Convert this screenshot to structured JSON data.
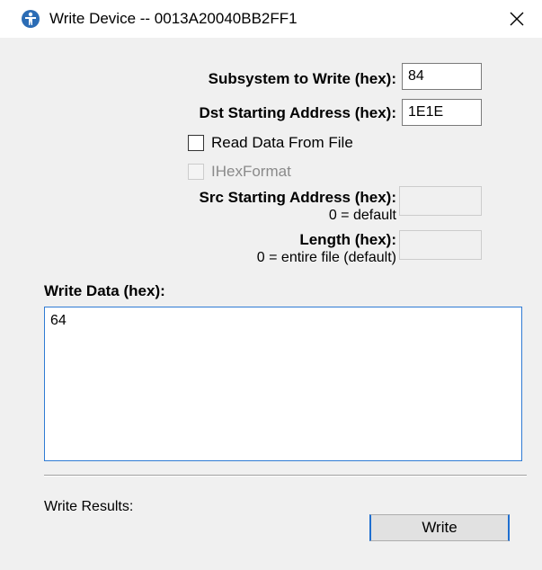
{
  "window": {
    "title": "Write Device -- 0013A20040BB2FF1",
    "app_icon": "xctu-app-icon",
    "close_icon": "close-icon"
  },
  "form": {
    "subsystem": {
      "label": "Subsystem to Write (hex):",
      "value": "84"
    },
    "dst_address": {
      "label": "Dst Starting Address (hex):",
      "value": "1E1E"
    },
    "read_from_file": {
      "label": "Read Data From File",
      "checked": false
    },
    "ihex_format": {
      "label": "IHexFormat",
      "checked": false,
      "enabled": false
    },
    "src_address": {
      "label": "Src Starting Address (hex):",
      "sublabel": "0 = default",
      "value": ""
    },
    "length": {
      "label": "Length (hex):",
      "sublabel": "0 = entire file (default)",
      "value": ""
    }
  },
  "write_data": {
    "label": "Write Data (hex):",
    "value": "64"
  },
  "results": {
    "label": "Write Results:"
  },
  "actions": {
    "write_label": "Write"
  },
  "colors": {
    "focus_border": "#2f7bd4",
    "button_accent": "#1f6fd0",
    "dialog_bg": "#f0f0f0"
  }
}
